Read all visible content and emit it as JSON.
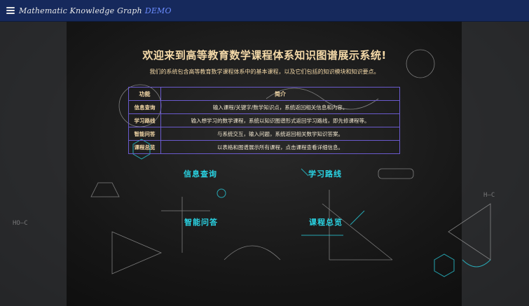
{
  "navbar": {
    "brand": "Mathematic Knowledge Graph",
    "badge": "DEMO",
    "menu_icon": "hamburger-menu-icon"
  },
  "welcome": {
    "title": "欢迎来到高等教育数学课程体系知识图谱展示系统!",
    "subtitle": "我们的系统包含高等教育数学课程体系中的基本课程，以及它们包括的知识模块和知识要点。"
  },
  "features_table": {
    "headers": [
      "功能",
      "简介"
    ],
    "rows": [
      {
        "function": "信息查询",
        "description": "输入课程/关键字/数学知识点，系统返回相关信息和内容。"
      },
      {
        "function": "学习路线",
        "description": "输入想学习的数学课程，系统以知识图谱形式返回学习路线，即先修课程等。"
      },
      {
        "function": "智能问答",
        "description": "与系统交互，输入问题，系统返回相关数学知识答案。"
      },
      {
        "function": "课程总览",
        "description": "以表格和图谱展示所有课程，点击课程查看详细信息。"
      }
    ]
  },
  "modules": [
    {
      "label": "信息查询"
    },
    {
      "label": "学习路线"
    },
    {
      "label": "智能问答"
    },
    {
      "label": "课程总览"
    }
  ],
  "colors": {
    "navbar": "#16295c",
    "title": "#f4d9a8",
    "module": "#2ad4e4",
    "table_border": "#6a5acd"
  }
}
